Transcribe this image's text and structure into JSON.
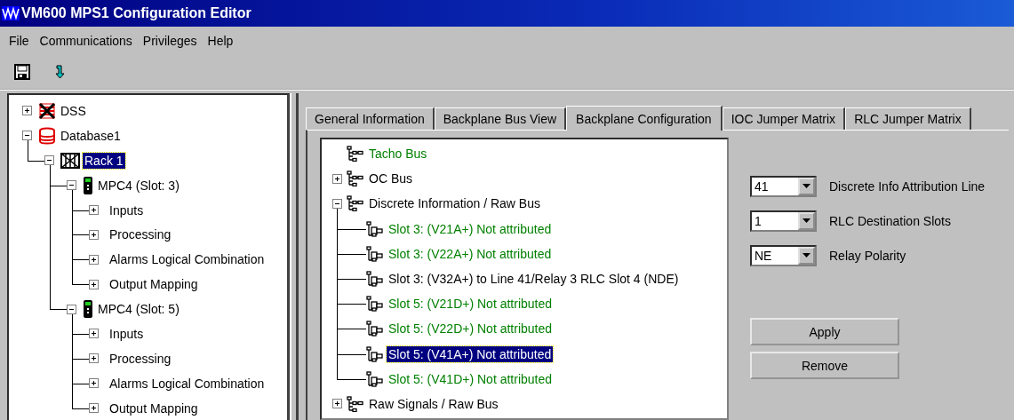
{
  "window": {
    "title": "VM600 MPS1 Configuration Editor"
  },
  "menu": [
    "File",
    "Communications",
    "Privileges",
    "Help"
  ],
  "tree": [
    {
      "label": "DSS",
      "kind": "dss",
      "expanded": false,
      "selected": false
    },
    {
      "label": "Database1",
      "kind": "database",
      "expanded": true,
      "selected": false,
      "children": [
        {
          "label": "Rack 1",
          "kind": "rack",
          "expanded": true,
          "selected": true,
          "children": [
            {
              "label": "MPC4 (Slot:  3)",
              "kind": "card",
              "expanded": true,
              "selected": false,
              "children": [
                {
                  "label": "Inputs",
                  "expanded": false,
                  "selected": false
                },
                {
                  "label": "Processing",
                  "expanded": false,
                  "selected": false
                },
                {
                  "label": "Alarms Logical Combination",
                  "expanded": false,
                  "selected": false
                },
                {
                  "label": "Output Mapping",
                  "expanded": false,
                  "selected": false
                }
              ]
            },
            {
              "label": "MPC4 (Slot:  5)",
              "kind": "card",
              "expanded": true,
              "selected": false,
              "children": [
                {
                  "label": "Inputs",
                  "expanded": false,
                  "selected": false
                },
                {
                  "label": "Processing",
                  "expanded": false,
                  "selected": false
                },
                {
                  "label": "Alarms Logical Combination",
                  "expanded": false,
                  "selected": false
                },
                {
                  "label": "Output Mapping",
                  "expanded": false,
                  "selected": false
                }
              ]
            }
          ]
        }
      ]
    }
  ],
  "tabs": [
    {
      "label": "General Information",
      "selected": false
    },
    {
      "label": "Backplane Bus View",
      "selected": false
    },
    {
      "label": "Backplane Configuration",
      "selected": true
    },
    {
      "label": "IOC Jumper Matrix",
      "selected": false
    },
    {
      "label": "RLC Jumper Matrix",
      "selected": false
    }
  ],
  "bus_tree": [
    {
      "label": "Tacho Bus",
      "kind": "bus",
      "color": "#008000",
      "selected": false
    },
    {
      "label": "OC Bus",
      "kind": "bus",
      "color": "#000000",
      "expanded": false,
      "selected": false
    },
    {
      "label": "Discrete Information / Raw Bus",
      "kind": "bus",
      "color": "#000000",
      "expanded": true,
      "selected": false,
      "children": [
        {
          "label": "Slot 3: (V21A+) Not attributed",
          "kind": "signal",
          "color": "#008000",
          "selected": false
        },
        {
          "label": "Slot 3: (V22A+) Not attributed",
          "kind": "signal",
          "color": "#008000",
          "selected": false
        },
        {
          "label": "Slot 3: (V32A+) to Line 41/Relay 3 RLC Slot 4 (NDE)",
          "kind": "signal",
          "color": "#000000",
          "selected": false
        },
        {
          "label": "Slot 5: (V21D+) Not attributed",
          "kind": "signal",
          "color": "#008000",
          "selected": false
        },
        {
          "label": "Slot 5: (V22D+) Not attributed",
          "kind": "signal",
          "color": "#008000",
          "selected": false
        },
        {
          "label": "Slot 5: (V41A+) Not attributed",
          "kind": "signal",
          "selected": true
        },
        {
          "label": "Slot 5: (V41D+) Not attributed",
          "kind": "signal",
          "color": "#008000",
          "selected": false
        }
      ]
    },
    {
      "label": "Raw Signals / Raw Bus",
      "kind": "bus",
      "color": "#000000",
      "expanded": false,
      "selected": false
    }
  ],
  "fields": [
    {
      "value": "41",
      "label": "Discrete Info Attribution Line"
    },
    {
      "value": "1",
      "label": "RLC Destination Slots"
    },
    {
      "value": "NE",
      "label": "Relay Polarity"
    }
  ],
  "buttons": [
    "Apply",
    "Remove"
  ]
}
